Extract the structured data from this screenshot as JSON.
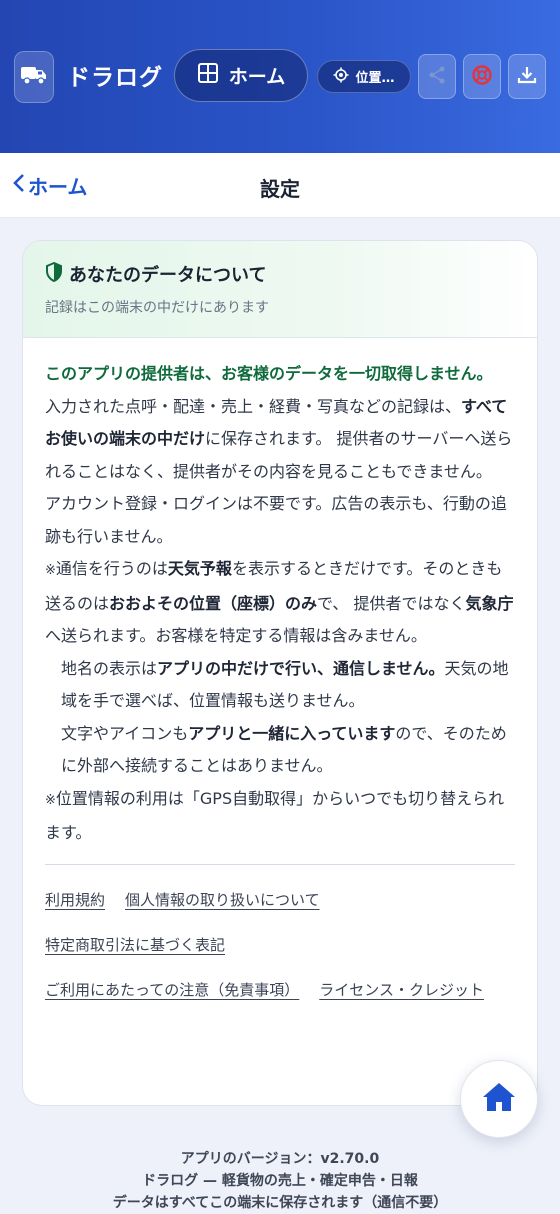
{
  "colors": {
    "header_gradient_start": "#2346b3",
    "header_gradient_end": "#3a6be0",
    "accent_blue": "#1e54cf",
    "green_lead": "#0f6a3c",
    "notice_icon": "#e5333a"
  },
  "header": {
    "app_title": "ドラログ",
    "home_label": "ホーム",
    "location_label": "位置…",
    "icons": [
      "truck-icon",
      "grid-icon",
      "location-icon",
      "share-icon",
      "lifebuoy-icon",
      "download-icon"
    ]
  },
  "nav": {
    "back_label": "ホーム",
    "title": "設定"
  },
  "privacy": {
    "title": "あなたのデータについて",
    "subtitle": "記録はこの端末の中だけにあります",
    "lead": "このアプリの提供者は、お客様のデータを一切取得しません。",
    "p1_before": "入力された点呼・配達・売上・経費・写真などの記録は、",
    "p1_bold": "すべてお使いの端末の中だけ",
    "p1_after": "に保存されます。 提供者のサーバーへ送られることはなく、提供者がその内容を見ることもできません。",
    "p2": "アカウント登録・ログインは不要です。広告の表示も、行動の追跡も行いません。",
    "note_mark_1": "※",
    "p3_a": "通信を行うのは",
    "p3_b": "天気予報",
    "p3_c": "を表示するときだけです。そのときも送るのは",
    "p3_d": "おおよその位置（座標）のみ",
    "p3_e": "で、 提供者ではなく",
    "p3_f": "気象庁",
    "p3_g": "へ送られます。お客様を特定する情報は含みません。",
    "p4_a": "地名の表示は",
    "p4_b": "アプリの中だけで行い、通信しません。",
    "p4_c": "天気の地域を手で選べば、位置情報も送りません。",
    "p5_a": "文字やアイコンも",
    "p5_b": "アプリと一緒に入っています",
    "p5_c": "ので、そのために外部へ接続することはありません。",
    "note_mark_2": "※",
    "p6": "位置情報の利用は「GPS自動取得」からいつでも切り替えられます。"
  },
  "links": {
    "terms": "利用規約",
    "privacy_policy": "個人情報の取り扱いについて",
    "tokushoho": "特定商取引法に基づく表記",
    "disclaimer": "ご利用にあたっての注意（免責事項）",
    "license": "ライセンス・クレジット"
  },
  "footer": {
    "version": "アプリのバージョン：v2.70.0",
    "tagline": "ドラログ — 軽貨物の売上・確定申告・日報",
    "storage": "データはすべてこの端末に保存されます（通信不要）"
  }
}
